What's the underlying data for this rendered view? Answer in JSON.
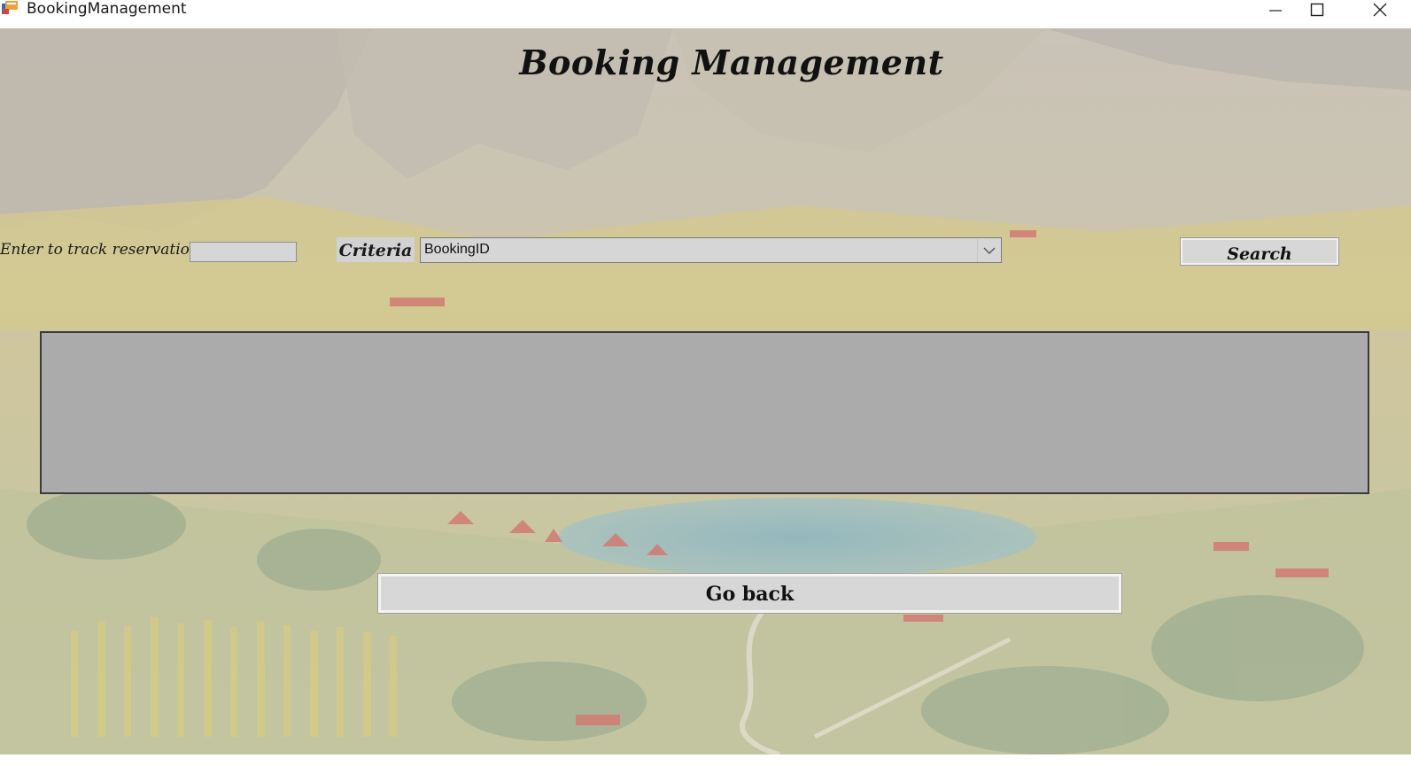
{
  "window": {
    "title": "BookingManagement",
    "icon": "app-form-icon",
    "controls": {
      "minimize_icon": "minimize-icon",
      "maximize_icon": "maximize-icon",
      "close_icon": "close-icon"
    }
  },
  "form": {
    "heading": "Booking Management",
    "track_label": "Enter to track reservation",
    "track_input_value": "",
    "criteria_label": "Criteria",
    "criteria_selected": "BookingID",
    "search_label": "Search",
    "go_back_label": "Go back"
  },
  "colors": {
    "control_gray": "#d6d6d6",
    "grid_gray": "#ababab",
    "grid_border": "#3a3a3a",
    "text": "#111111"
  }
}
